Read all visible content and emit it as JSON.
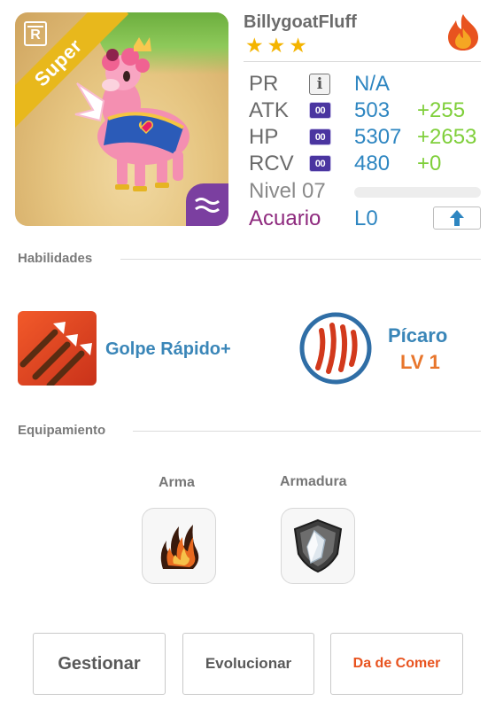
{
  "pet": {
    "name": "BillygoatFluff",
    "stars": 3,
    "rarity_letter": "R",
    "badge": "Super",
    "element_icon": "fire-icon",
    "portrait_element_icon": "water-waves-icon"
  },
  "stats": {
    "pr": {
      "label": "PR",
      "value": "N/A"
    },
    "atk": {
      "label": "ATK",
      "value": "503",
      "bonus": "+255",
      "skill_icon_text": "00"
    },
    "hp": {
      "label": "HP",
      "value": "5307",
      "bonus": "+2653",
      "skill_icon_text": "00"
    },
    "rcv": {
      "label": "RCV",
      "value": "480",
      "bonus": "+0",
      "skill_icon_text": "00"
    },
    "level": {
      "label": "Nivel 07",
      "progress": 0.0
    },
    "element": {
      "label": "Acuario",
      "value": "L0"
    }
  },
  "sections": {
    "abilities": "Habilidades",
    "equipment": "Equipamiento"
  },
  "ability": {
    "name": "Golpe Rápido+",
    "icon": "triple-arrow-icon"
  },
  "pet_class": {
    "name": "Pícaro",
    "level": "LV 1",
    "icon": "claw-marks-icon"
  },
  "equipment": {
    "weapon_label": "Arma",
    "armor_label": "Armadura",
    "weapon_icon": "flame-claw-icon",
    "armor_icon": "crystal-shield-icon"
  },
  "buttons": {
    "manage": "Gestionar",
    "evolve": "Evolucionar",
    "feed": "Da de Comer"
  },
  "colors": {
    "blue": "#2e86c1",
    "green": "#7fcf3a",
    "purple_element": "#8e2a7e",
    "orange": "#e8762c",
    "badge_gold": "#e8b81c"
  }
}
